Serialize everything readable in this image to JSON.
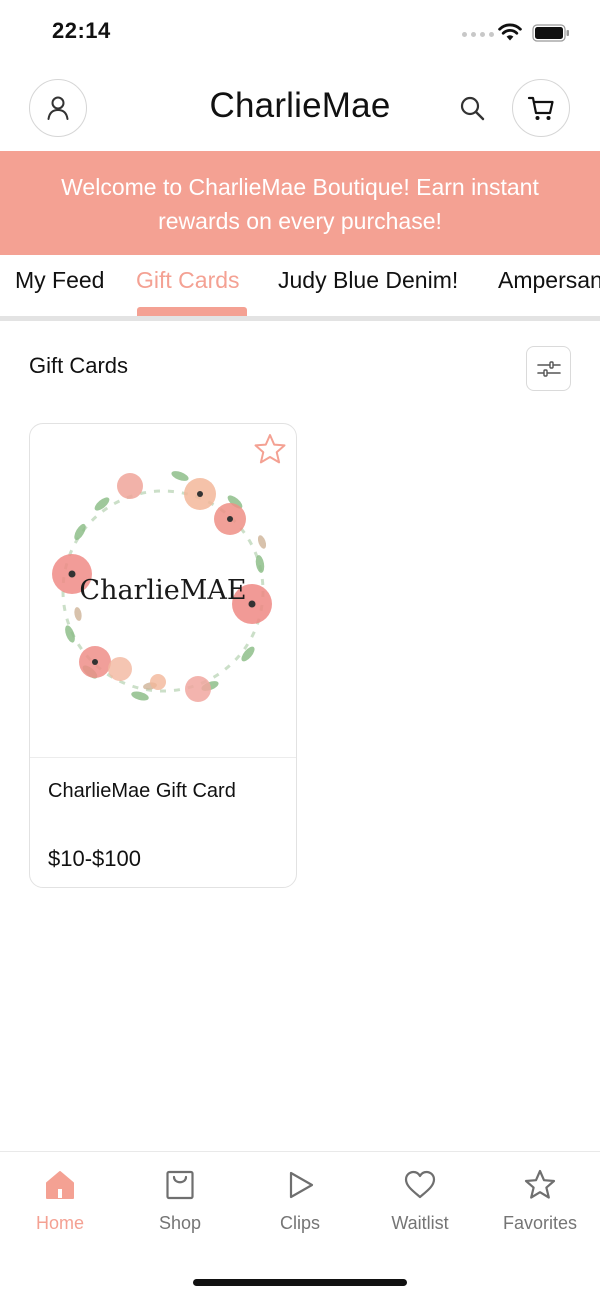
{
  "status_bar": {
    "time": "22:14"
  },
  "header": {
    "title": "CharlieMae"
  },
  "banner": {
    "line1": "Welcome to CharlieMae Boutique! Earn instant",
    "line2": "rewards on every purchase!"
  },
  "tabs": [
    {
      "label": "My Feed",
      "active": false
    },
    {
      "label": "Gift Cards",
      "active": true
    },
    {
      "label": "Judy Blue Denim!",
      "active": false
    },
    {
      "label": "Ampersand",
      "active": false
    }
  ],
  "section": {
    "title": "Gift Cards"
  },
  "products": [
    {
      "name": "CharlieMae Gift Card",
      "price": "$10-$100",
      "logo_text": "CharlieMAE",
      "favorited": false
    }
  ],
  "bottom_nav": [
    {
      "label": "Home",
      "icon": "home-icon",
      "active": true
    },
    {
      "label": "Shop",
      "icon": "shopping-bag-icon",
      "active": false
    },
    {
      "label": "Clips",
      "icon": "play-icon",
      "active": false
    },
    {
      "label": "Waitlist",
      "icon": "heart-icon",
      "active": false
    },
    {
      "label": "Favorites",
      "icon": "star-icon",
      "active": false
    }
  ],
  "colors": {
    "accent": "#f4a193",
    "text": "#111111",
    "muted": "#757575",
    "border": "#e2e2e2"
  }
}
